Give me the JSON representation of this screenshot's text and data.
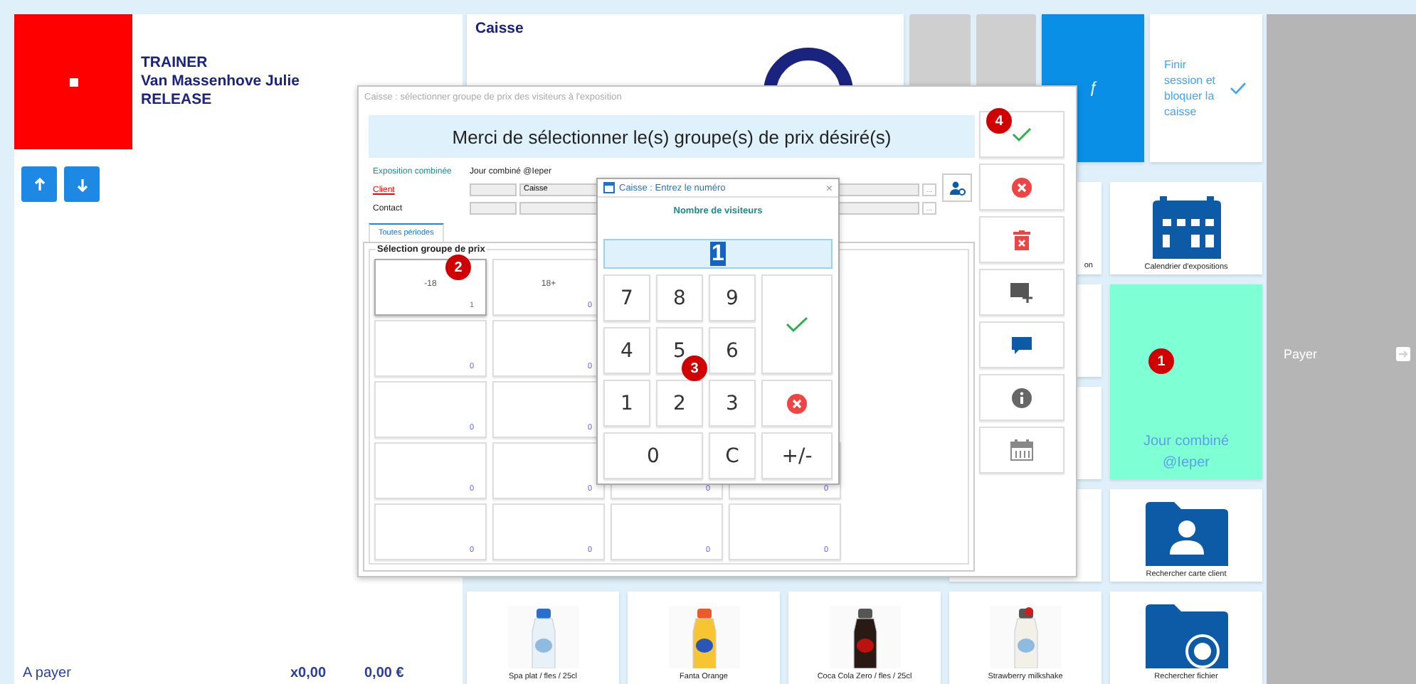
{
  "user_panel": {
    "role": "TRAINER",
    "name": "Van Massenhove Julie",
    "build": "RELEASE"
  },
  "totals": {
    "label": "A payer",
    "quantity": "x0,00",
    "amount": "0,00 €"
  },
  "top_tiles": [
    {
      "kind": "caisse",
      "label": "Caisse"
    },
    {
      "kind": "blank"
    },
    {
      "kind": "blank"
    },
    {
      "kind": "function",
      "label": "ƒ"
    },
    {
      "kind": "action",
      "label": "Finir session et bloquer la caisse"
    }
  ],
  "tile_columns": [
    [
      {
        "kind": "product",
        "label": "Spa plat / fles / 25cl"
      }
    ],
    [
      {
        "kind": "product",
        "label": "Fanta Orange"
      }
    ],
    [
      {
        "kind": "product",
        "label": "Coca Cola Zero / fles / 25cl"
      }
    ],
    [
      {
        "kind": "tile",
        "label": "on"
      },
      {
        "kind": "tile"
      },
      {
        "kind": "tile"
      },
      {
        "kind": "tile"
      },
      {
        "kind": "product",
        "label": "Strawberry milkshake"
      }
    ],
    [
      {
        "kind": "calendar",
        "label": "Calendrier d'expositions"
      },
      {
        "kind": "highlight",
        "label": "Jour combiné @Ieper",
        "badge": "1"
      },
      {
        "kind": "folder-person",
        "label": "Rechercher carte client"
      },
      {
        "kind": "folder-search",
        "label": "Rechercher fichier"
      }
    ]
  ],
  "pay_panel": {
    "label": "Payer"
  },
  "price_dialog": {
    "title": "Caisse : sélectionner groupe de prix des visiteurs à l'exposition",
    "prompt": "Merci de sélectionner le(s) groupe(s) de prix désiré(s)",
    "fields": [
      {
        "kind": "info",
        "label": "Exposition combinée",
        "value": "Jour combiné @Ieper"
      },
      {
        "kind": "link",
        "label": "Client",
        "value": "Caisse",
        "browse": "..."
      },
      {
        "kind": "plain",
        "label": "Contact",
        "browse": "..."
      }
    ],
    "tabs": [
      {
        "label": "Toutes périodes",
        "selected": true
      }
    ],
    "group_title": "Sélection groupe de prix",
    "price_groups": [
      [
        {
          "label": "-18",
          "count": "1",
          "selected": true,
          "badge": "2"
        },
        {
          "label": "18+",
          "count": "0",
          "selected": false
        }
      ],
      [
        {
          "count": "0",
          "selected": false
        },
        {
          "count": "0",
          "selected": false
        }
      ],
      [
        {
          "count": "0",
          "selected": false
        },
        {
          "count": "0",
          "selected": false
        }
      ],
      [
        {
          "count": "0",
          "selected": false
        },
        {
          "count": "0",
          "selected": false
        },
        {
          "count": "0",
          "selected": false
        },
        {
          "count": "0",
          "selected": false
        }
      ],
      [
        {
          "count": "0",
          "selected": false
        },
        {
          "count": "0",
          "selected": false
        },
        {
          "count": "0",
          "selected": false
        },
        {
          "count": "0",
          "selected": false
        }
      ]
    ],
    "actions": [
      {
        "kind": "confirm",
        "badge": "4"
      },
      {
        "kind": "cancel"
      },
      {
        "kind": "delete"
      },
      {
        "kind": "add-image"
      },
      {
        "kind": "comment"
      },
      {
        "kind": "info"
      },
      {
        "kind": "calendar"
      }
    ]
  },
  "numpad": {
    "title": "Caisse : Entrez le numéro",
    "close": "×",
    "prompt": "Nombre de visiteurs",
    "value": "1",
    "badge": "3",
    "keys": [
      {
        "kind": "digit",
        "label": "7"
      },
      {
        "kind": "digit",
        "label": "8"
      },
      {
        "kind": "digit",
        "label": "9"
      },
      {
        "kind": "confirm"
      },
      {
        "kind": "digit",
        "label": "4"
      },
      {
        "kind": "digit",
        "label": "5"
      },
      {
        "kind": "digit",
        "label": "6"
      },
      {
        "kind": "digit",
        "label": "1"
      },
      {
        "kind": "digit",
        "label": "2"
      },
      {
        "kind": "digit",
        "label": "3"
      },
      {
        "kind": "cancel"
      },
      {
        "kind": "wide",
        "label": "0"
      },
      {
        "kind": "digit",
        "label": "C"
      },
      {
        "kind": "digit",
        "label": "+/-"
      }
    ]
  }
}
